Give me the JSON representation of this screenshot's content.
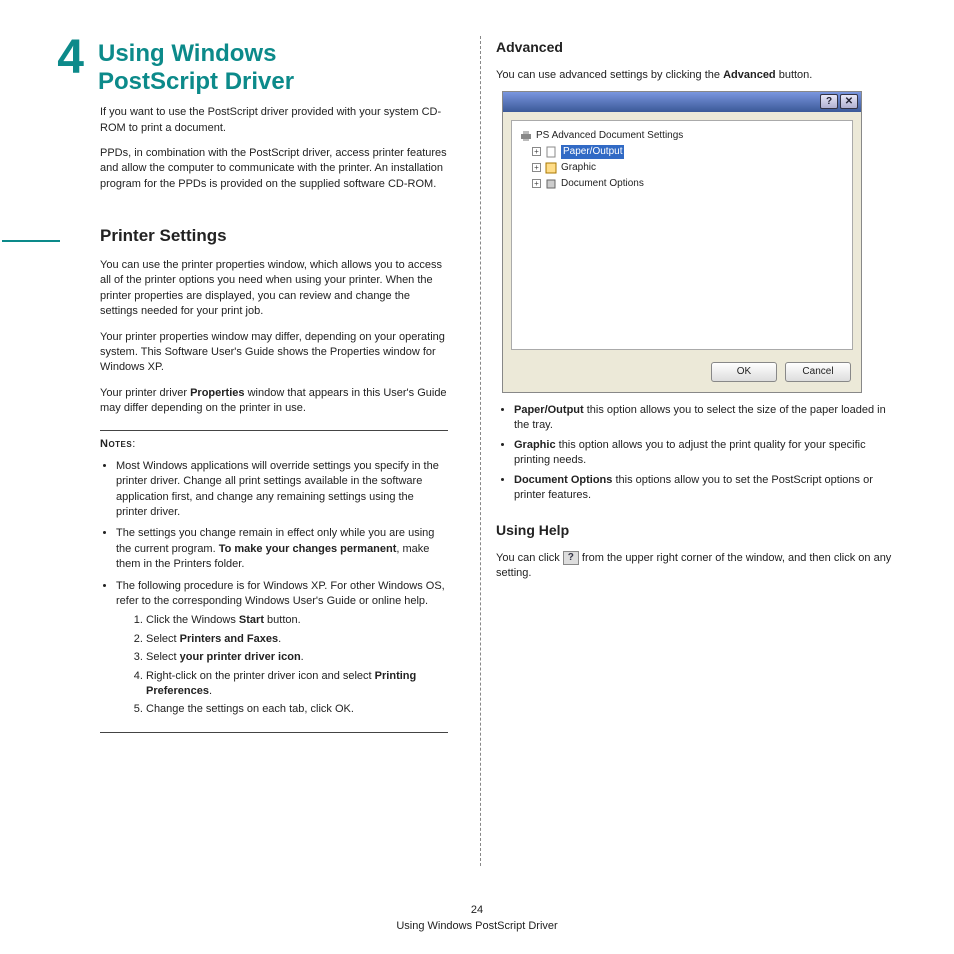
{
  "chapter": {
    "number": "4",
    "title_line1": "Using Windows",
    "title_line2": "PostScript Driver"
  },
  "intro": {
    "p1": "If you want to use the PostScript driver provided with your system CD-ROM to print a document.",
    "p2": "PPDs, in combination with the PostScript driver, access printer features and allow the computer to communicate with the printer. An installation program for the PPDs is provided on the supplied software CD-ROM."
  },
  "printer_settings": {
    "heading": "Printer Settings",
    "p1": "You can use the printer properties window, which allows you to access all of the printer options you need when using your printer. When the printer properties are displayed, you can review and change the settings needed for your print job.",
    "p2": "Your printer properties window may differ, depending on your operating system. This Software User's Guide shows the Properties window for Windows XP.",
    "p3_pre": "Your printer driver ",
    "p3_b": "Properties",
    "p3_post": " window that appears in this User's Guide may differ depending on the printer in use."
  },
  "notes": {
    "label": "Notes",
    "b1": "Most Windows applications will override settings you specify in the printer driver. Change all print settings available in the software application first, and change any remaining settings using the printer driver.",
    "b2_pre": "The settings you change remain in effect only while you are using the current program. ",
    "b2_b": "To make your changes permanent",
    "b2_post": ", make them in the Printers folder.",
    "b3": "The following procedure is for Windows XP. For other Windows OS, refer to the corresponding Windows User's Guide or online help.",
    "s1_pre": "Click the Windows ",
    "s1_b": "Start",
    "s1_post": " button.",
    "s2_pre": "Select ",
    "s2_b": "Printers and Faxes",
    "s2_post": ".",
    "s3_pre": "Select ",
    "s3_b": "your printer driver icon",
    "s3_post": ".",
    "s4_pre": "Right-click on the printer driver icon and select ",
    "s4_b": "Printing Preferences",
    "s4_post": ".",
    "s5": "Change the settings on each tab, click OK."
  },
  "advanced": {
    "heading": "Advanced",
    "intro_pre": "You can use advanced settings by clicking the ",
    "intro_b": "Advanced",
    "intro_post": " button.",
    "dialog": {
      "root": "PS Advanced Document Settings",
      "paper": "Paper/Output",
      "graphic": "Graphic",
      "docopt": "Document Options",
      "ok": "OK",
      "cancel": "Cancel",
      "help": "?",
      "close": "✕"
    },
    "items": {
      "paper_b": "Paper/Output",
      "paper_t": " this option allows you to select the size of the paper loaded in the tray.",
      "graphic_b": "Graphic",
      "graphic_t": " this option allows you to adjust the print quality for your specific printing needs.",
      "doc_b": "Document Options",
      "doc_t": " this options allow you to set the PostScript options or printer features."
    }
  },
  "help": {
    "heading": "Using Help",
    "pre": "You can click ",
    "icon": "?",
    "post": " from the upper right corner of the window, and then click on any setting."
  },
  "footer": {
    "page": "24",
    "title": "Using Windows PostScript Driver"
  }
}
